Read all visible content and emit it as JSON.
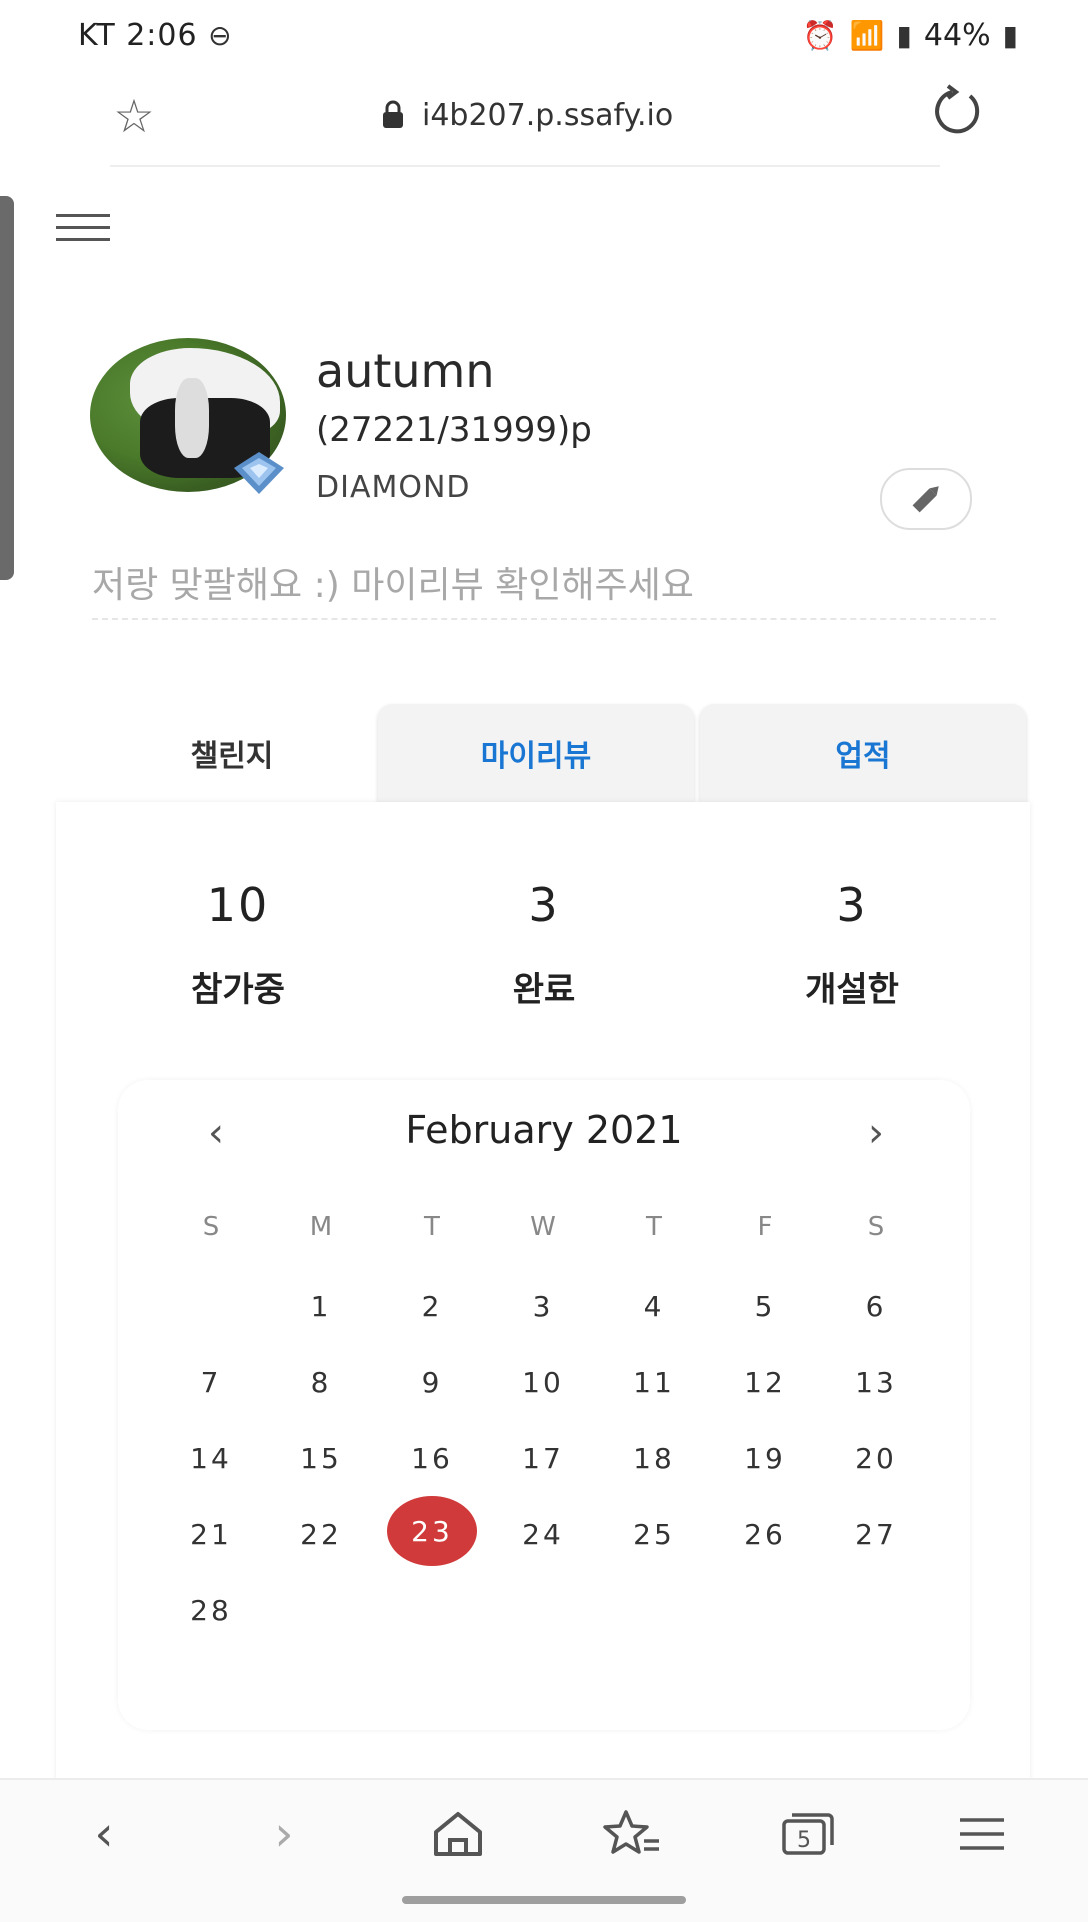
{
  "status_bar": {
    "carrier_time": "KT 2:06",
    "battery": "44%"
  },
  "browser": {
    "url": "i4b207.p.ssafy.io"
  },
  "profile": {
    "username": "autumn",
    "points": "(27221/31999)p",
    "rank": "DIAMOND",
    "bio_placeholder": "저랑 맞팔해요 :) 마이리뷰 확인해주세요"
  },
  "tabs": [
    {
      "label": "챌린지"
    },
    {
      "label": "마이리뷰"
    },
    {
      "label": "업적"
    }
  ],
  "stats": [
    {
      "value": "10",
      "label": "참가중"
    },
    {
      "value": "3",
      "label": "완료"
    },
    {
      "value": "3",
      "label": "개설한"
    }
  ],
  "calendar": {
    "title": "February 2021",
    "weekdays": [
      "S",
      "M",
      "T",
      "W",
      "T",
      "F",
      "S"
    ],
    "days": [
      "1",
      "2",
      "3",
      "4",
      "5",
      "6",
      "7",
      "8",
      "9",
      "10",
      "11",
      "12",
      "13",
      "14",
      "15",
      "16",
      "17",
      "18",
      "19",
      "20",
      "21",
      "22",
      "23",
      "24",
      "25",
      "26",
      "27",
      "28"
    ],
    "selected": "23"
  },
  "colors": {
    "accent_blue": "#1976d2",
    "selected_day": "#d13a3a"
  },
  "bottom_nav": {
    "tab_count": "5"
  }
}
